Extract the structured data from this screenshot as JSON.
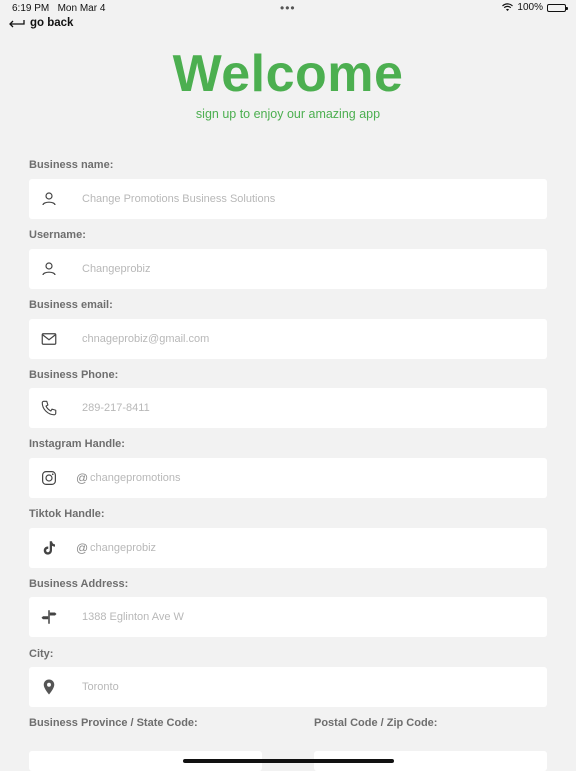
{
  "status_bar": {
    "time": "6:19 PM",
    "date": "Mon Mar 4",
    "dots": "•••",
    "battery": "100%"
  },
  "nav": {
    "back_label": "go back"
  },
  "header": {
    "title": "Welcome",
    "subtitle": "sign up to enjoy our amazing app"
  },
  "fields": [
    {
      "label": "Business name:",
      "placeholder": "Change Promotions Business Solutions",
      "icon": "user-icon"
    },
    {
      "label": "Username:",
      "placeholder": "Changeprobiz",
      "icon": "user-icon"
    },
    {
      "label": "Business email:",
      "placeholder": "chnageprobiz@gmail.com",
      "icon": "mail-icon"
    },
    {
      "label": "Business Phone:",
      "placeholder": "289-217-8411",
      "icon": "phone-icon"
    },
    {
      "label": "Instagram Handle:",
      "prefix": "@",
      "placeholder": "changepromotions",
      "icon": "instagram-icon"
    },
    {
      "label": "Tiktok Handle:",
      "prefix": "@",
      "placeholder": "changeprobiz",
      "icon": "tiktok-icon"
    },
    {
      "label": "Business Address:",
      "placeholder": "1388 Eglinton Ave W",
      "icon": "signpost-icon"
    },
    {
      "label": "City:",
      "placeholder": "Toronto",
      "icon": "location-pin-icon"
    }
  ],
  "bottom_labels": {
    "province": "Business Province / State Code:",
    "postal": "Postal Code / Zip Code:"
  },
  "colors": {
    "accent": "#4CAF50",
    "background": "#f2f2f2"
  }
}
